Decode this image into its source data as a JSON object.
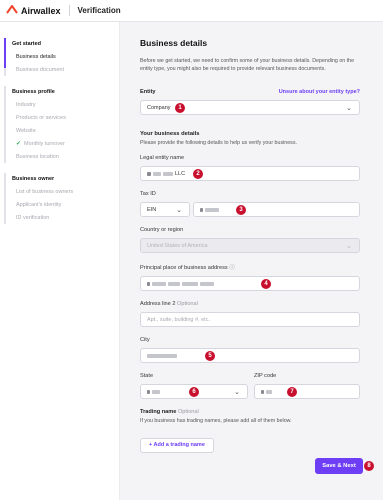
{
  "header": {
    "brand": "Airwallex",
    "title": "Verification",
    "logo_icon": "airwallex-logo-icon"
  },
  "sidebar": {
    "sections": [
      {
        "title": "Get started",
        "items": [
          "Business details",
          "Business document"
        ]
      },
      {
        "title": "Business profile",
        "items": [
          "Industry",
          "Products or services",
          "Website",
          "Monthly turnover",
          "Business location"
        ]
      },
      {
        "title": "Business owner",
        "items": [
          "List of business owners",
          "Applicant's identity",
          "ID verification"
        ]
      }
    ],
    "active_item": "Business details",
    "completed_item": "Monthly turnover"
  },
  "form": {
    "title": "Business details",
    "intro": "Before we get started, we need to confirm some of your business details. Depending on the entity type, you might also be required to provide relevant business documents.",
    "entity": {
      "label": "Entity",
      "help_link": "Unsure about your entity type?",
      "value": "Company"
    },
    "your_details": {
      "heading": "Your business details",
      "text": "Please provide the following details to help us verify your business."
    },
    "legal_name": {
      "label": "Legal entity name",
      "suffix": "LLC"
    },
    "tax_id": {
      "label": "Tax ID",
      "type": "EIN"
    },
    "country": {
      "label": "Country or region",
      "value": "United States of America"
    },
    "principal_address": {
      "label": "Principal place of business address",
      "info_icon": "info-icon"
    },
    "address_line2": {
      "label": "Address line 2",
      "optional": "Optional",
      "placeholder": "Apt., suite, building #, etc."
    },
    "city": {
      "label": "City"
    },
    "state": {
      "label": "State"
    },
    "zip": {
      "label": "ZIP code"
    },
    "trading_name": {
      "label": "Trading name",
      "optional": "Optional",
      "text": "If you business has trading names, please add all of them below.",
      "button": "+ Add a trading name"
    },
    "save_button": "Save & Next"
  },
  "annotations": [
    "1",
    "2",
    "3",
    "4",
    "5",
    "6",
    "7",
    "8"
  ],
  "colors": {
    "accent": "#6d3ef5",
    "brand": "#f0442c",
    "badge": "#c8102e",
    "check": "#28a745"
  }
}
